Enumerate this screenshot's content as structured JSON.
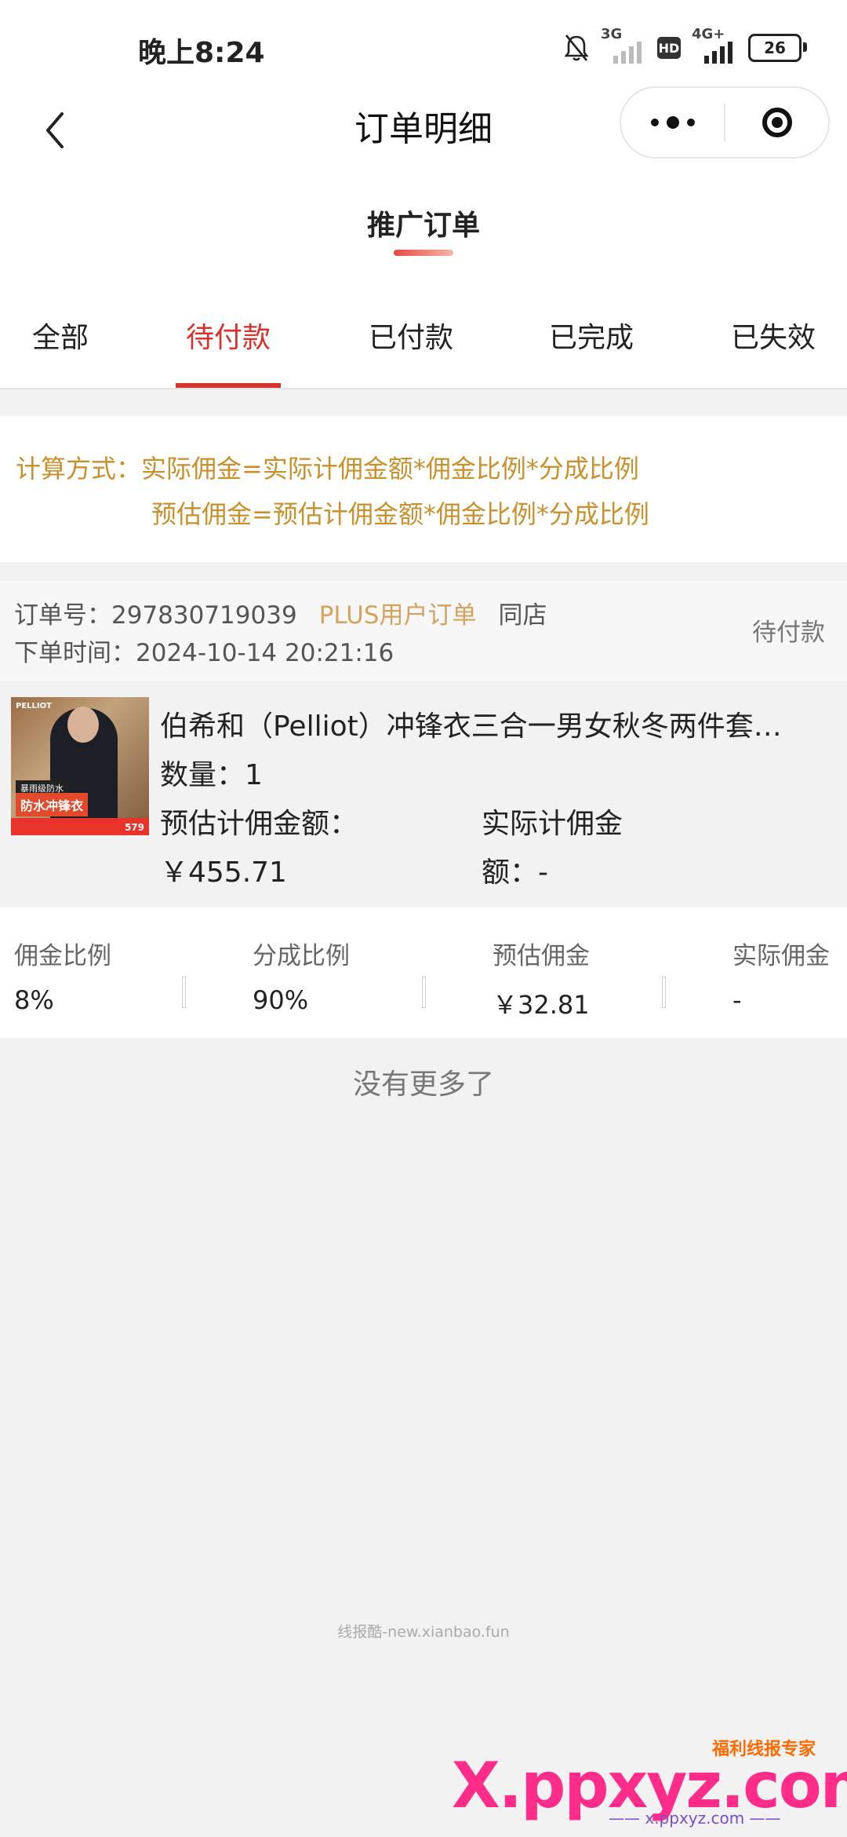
{
  "status_bar": {
    "time": "晚上8:24",
    "net1": "3G",
    "hd": "HD",
    "net2": "4G+",
    "battery": "26"
  },
  "nav": {
    "title": "订单明细"
  },
  "section": {
    "title": "推广订单"
  },
  "tabs": [
    {
      "label": "全部"
    },
    {
      "label": "待付款"
    },
    {
      "label": "已付款"
    },
    {
      "label": "已完成"
    },
    {
      "label": "已失效"
    }
  ],
  "active_tab": "待付款",
  "calc": {
    "line1": "计算方式：实际佣金=实际计佣金额*佣金比例*分成比例",
    "line2": "预估佣金=预估计佣金额*佣金比例*分成比例"
  },
  "order": {
    "order_no_label": "订单号：297830719039",
    "plus_tag": "PLUS用户订单",
    "store_tag": "同店",
    "time_label": "下单时间：2024-10-14 20:21:16",
    "status": "待付款"
  },
  "product": {
    "thumb_brand": "PELLIOT",
    "thumb_band1": "暴雨级防水",
    "thumb_band2": "防水冲锋衣",
    "thumb_price": "579",
    "title": "伯希和（Pelliot）冲锋衣三合一男女秋冬两件套…",
    "quantity": "数量：1",
    "est_label": "预估计佣金额：",
    "est_value": "￥455.71",
    "act_label": "实际计佣金",
    "act_value": "额：-"
  },
  "stats": [
    {
      "key": "佣金比例",
      "value": "8%"
    },
    {
      "key": "分成比例",
      "value": "90%"
    },
    {
      "key": "预估佣金",
      "value": "￥32.81"
    },
    {
      "key": "实际佣金",
      "value": "-"
    }
  ],
  "no_more": "没有更多了",
  "footer_note": "线报酷-new.xianbao.fun",
  "watermark": {
    "small": "福利线报专家",
    "main": "X.ppxyz.com",
    "sub": "—— x.ppxyz.com ——"
  }
}
